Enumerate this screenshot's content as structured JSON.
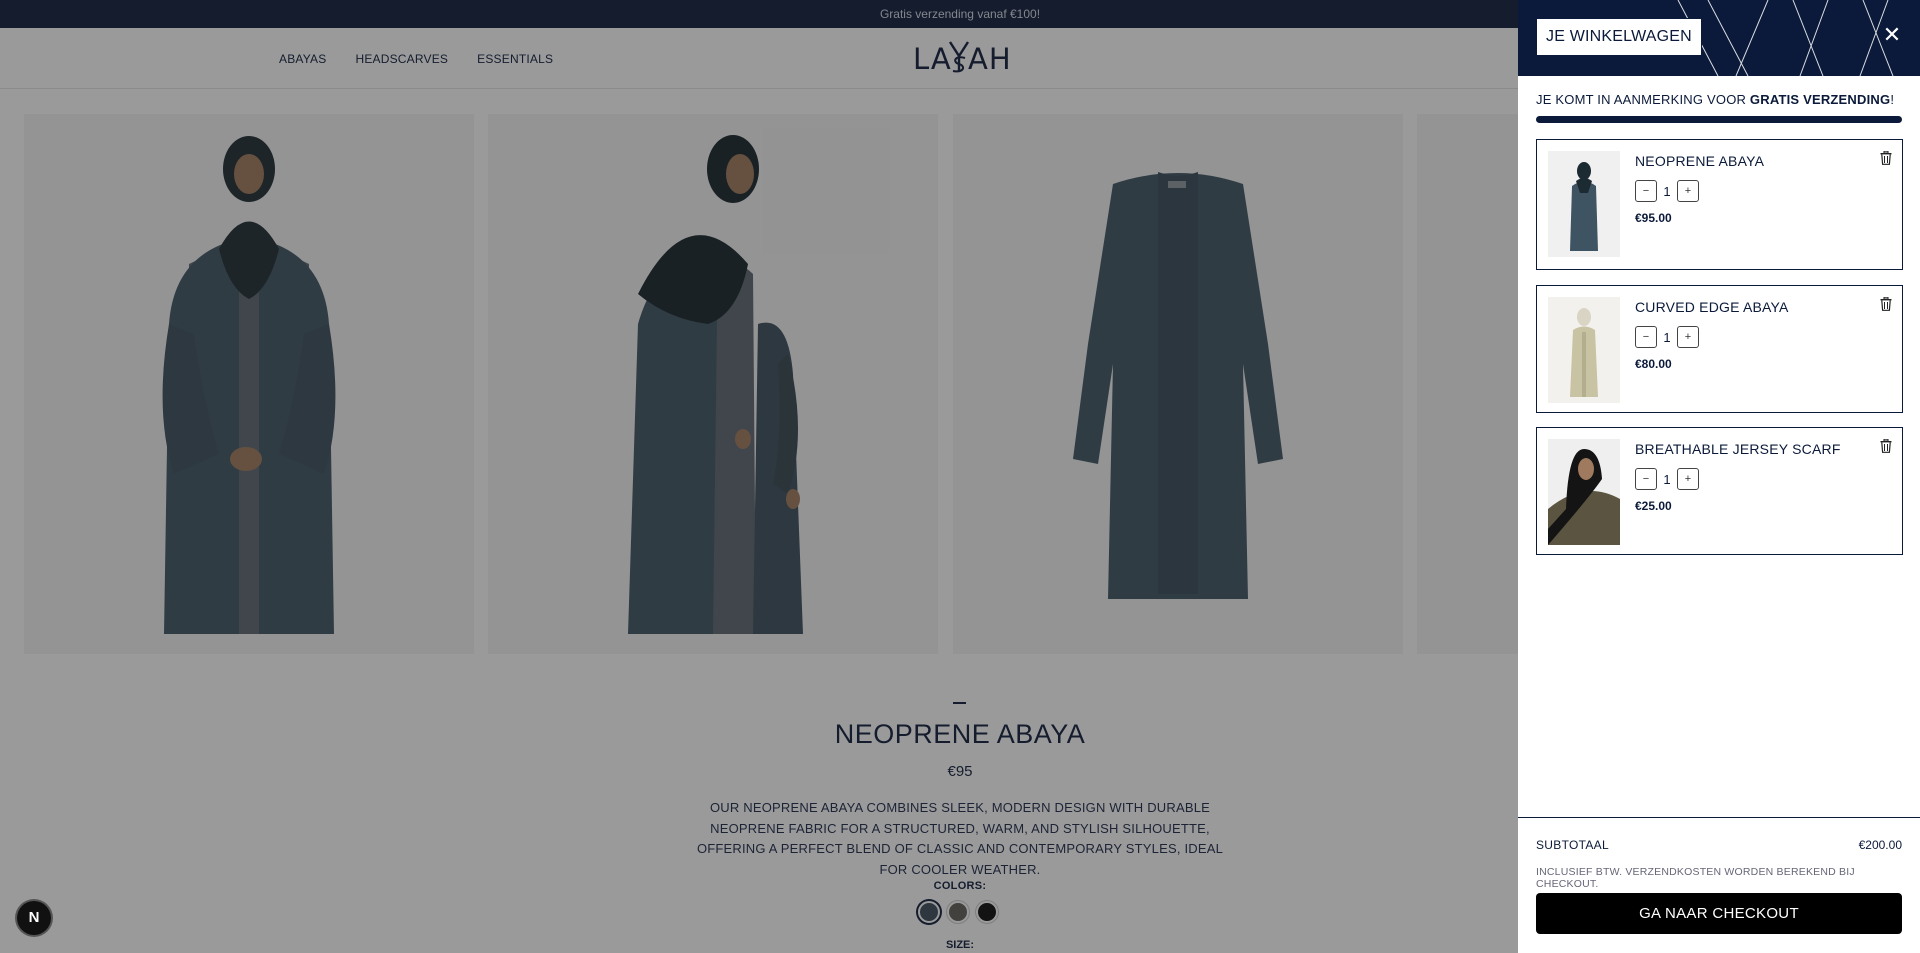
{
  "announcement": {
    "text": "Gratis verzending vanaf €100!"
  },
  "header": {
    "nav": [
      "ABAYAS",
      "HEADSCARVES",
      "ESSENTIALS"
    ],
    "logo": "LAYSAH"
  },
  "product": {
    "name": "NEOPRENE ABAYA",
    "price": "€95",
    "description": "OUR NEOPRENE ABAYA COMBINES SLEEK, MODERN DESIGN WITH DURABLE NEOPRENE FABRIC FOR A STRUCTURED, WARM, AND STYLISH SILHOUETTE, OFFERING A PERFECT BLEND OF CLASSIC AND CONTEMPORARY STYLES, IDEAL FOR COOLER WEATHER.",
    "colors_label": "COLORS:",
    "colors": [
      "#3b4b5a",
      "#5f5e58",
      "#0a0a0a"
    ],
    "selected_color": 0,
    "size_label": "SIZE:"
  },
  "badge": {
    "letter": "N"
  },
  "cart": {
    "title": "JE WINKELWAGEN",
    "shipping_prefix": "JE KOMT IN AANMERKING VOOR ",
    "shipping_bold": "GRATIS VERZENDING",
    "shipping_suffix": "!",
    "shipping_progress": 1.0,
    "items": [
      {
        "name": "NEOPRENE ABAYA",
        "qty": "1",
        "price": "€95.00",
        "minus": "−",
        "plus": "+"
      },
      {
        "name": "CURVED EDGE ABAYA",
        "qty": "1",
        "price": "€80.00",
        "minus": "−",
        "plus": "+"
      },
      {
        "name": "BREATHABLE JERSEY SCARF",
        "qty": "1",
        "price": "€25.00",
        "minus": "−",
        "plus": "+"
      }
    ],
    "subtotal_label": "SUBTOTAAL",
    "subtotal_value": "€200.00",
    "tax_note": "INCLUSIEF BTW. VERZENDKOSTEN WORDEN BEREKEND BIJ CHECKOUT.",
    "checkout_label": "GA NAAR CHECKOUT",
    "close_symbol": "✕"
  },
  "colors": {
    "navy": "#0b1a3a",
    "abaya": "#3f5463",
    "overlay": "rgba(30,30,30,0.45)"
  }
}
